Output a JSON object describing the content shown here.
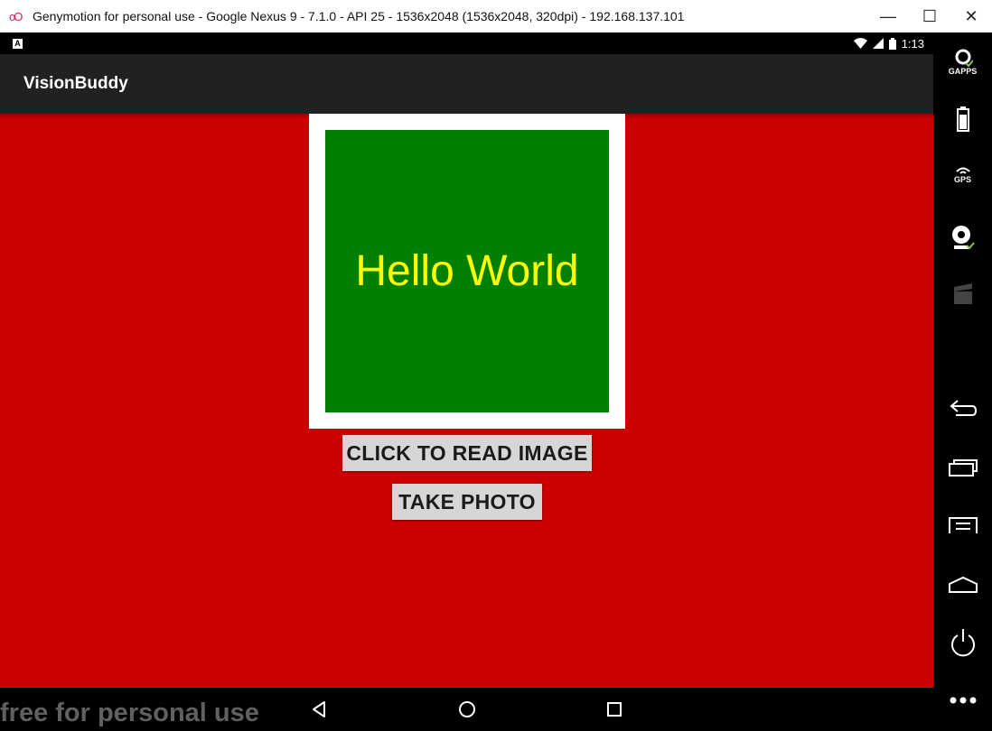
{
  "window": {
    "title": "Genymotion for personal use - Google Nexus 9 - 7.1.0 - API 25 - 1536x2048 (1536x2048, 320dpi) - 192.168.137.101",
    "logo": "oO",
    "controls": {
      "minimize": "—",
      "maximize": "☐",
      "close": "✕"
    }
  },
  "statusbar": {
    "notification_icon": "A",
    "time": "1:13"
  },
  "app": {
    "title": "VisionBuddy",
    "image_text": "Hello World",
    "read_button": "CLICK TO READ IMAGE",
    "photo_button": "TAKE PHOTO"
  },
  "watermark": "free for personal use",
  "sidebar": {
    "gaps_label": "GAPPS",
    "gps_label": "GPS"
  },
  "colors": {
    "background": "#cc0000",
    "toolbar": "#212121",
    "image_bg": "#008000",
    "image_text": "#ffff00",
    "button": "#d6d6d6"
  }
}
